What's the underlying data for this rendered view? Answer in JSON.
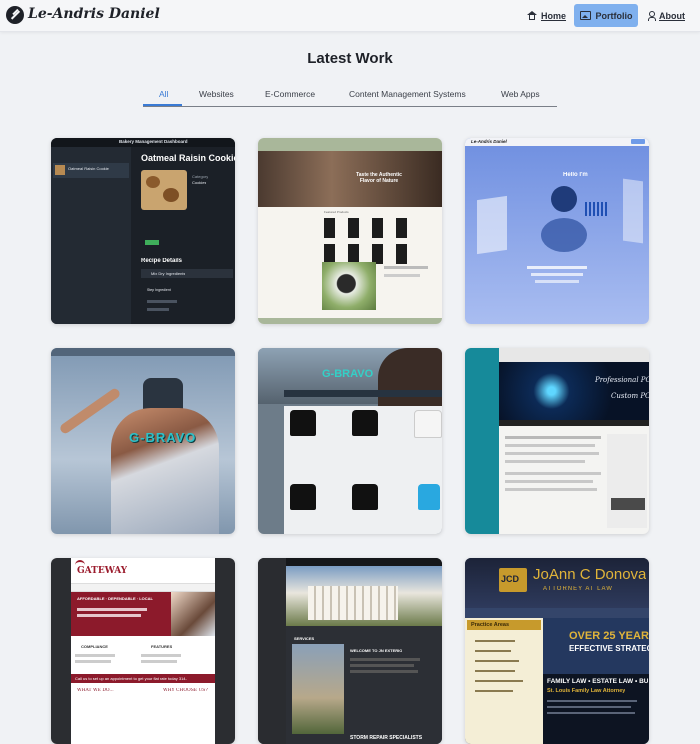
{
  "nav": {
    "brand": "Le-Andris Daniel",
    "links": [
      {
        "label": "Home",
        "icon": "home-icon",
        "active": false
      },
      {
        "label": "Portfolio",
        "icon": "image-icon",
        "active": true
      },
      {
        "label": "About",
        "icon": "user-icon",
        "active": false
      }
    ]
  },
  "page": {
    "title": "Latest Work",
    "tabs": [
      "All",
      "Websites",
      "E-Commerce",
      "Content Management Systems",
      "Web Apps"
    ],
    "active_tab": "All"
  },
  "colors": {
    "accent": "#3a7bd5",
    "active_nav_bg": "#7fb0ee",
    "background": "#f0f2f5",
    "text": "#1e2128"
  },
  "portfolio": {
    "bakery": {
      "header": "Bakery Management Dashboard",
      "list_item": "Oatmeal Raisin Cookie",
      "title": "Oatmeal Raisin Cookie",
      "category_label": "Category",
      "category": "Cookies",
      "section": "Recipe Details",
      "subsection": "Mix Dry Ingredients",
      "step": "Step Ingredient"
    },
    "coffee": {
      "hero": "Taste the Authentic Flavor of Nature",
      "section": "Featured Products"
    },
    "portfolio_site": {
      "brand": "Le-Andris Daniel",
      "hello": "Hello I'm"
    },
    "gbravo": {
      "logo": "G-BRAVO"
    },
    "gbravo_store": {
      "logo": "G-BRAVO"
    },
    "pc": {
      "hero_line1": "Professional PC R",
      "hero_line2": "Custom PC's"
    },
    "gateway": {
      "logo": "GATEWAY",
      "tagline": "AFFORDABLE · DEPENDABLE · LOCAL",
      "features": "FEATURES",
      "compliance": "COMPLIANCE",
      "call": "Call us to set up an appointment to get your flat rate today 314-",
      "what": "WHAT WE DO...",
      "why": "WHY CHOOSE US?"
    },
    "realestate": {
      "welcome": "WELCOME TO JN EXTERIO",
      "services": "SERVICES",
      "banner": "STORM REPAIR SPECIALISTS"
    },
    "law": {
      "monogram": "JCD",
      "name": "JoAnn C Donova",
      "subtitle": "ATTORNEY AT LAW",
      "practice": "Practice Areas",
      "years": "OVER 25 YEARS O",
      "effective": "EFFECTIVE STRATEGIES",
      "areas": "FAMILY LAW • ESTATE LAW • BU",
      "footer": "St. Louis Family Law Attorney"
    }
  }
}
